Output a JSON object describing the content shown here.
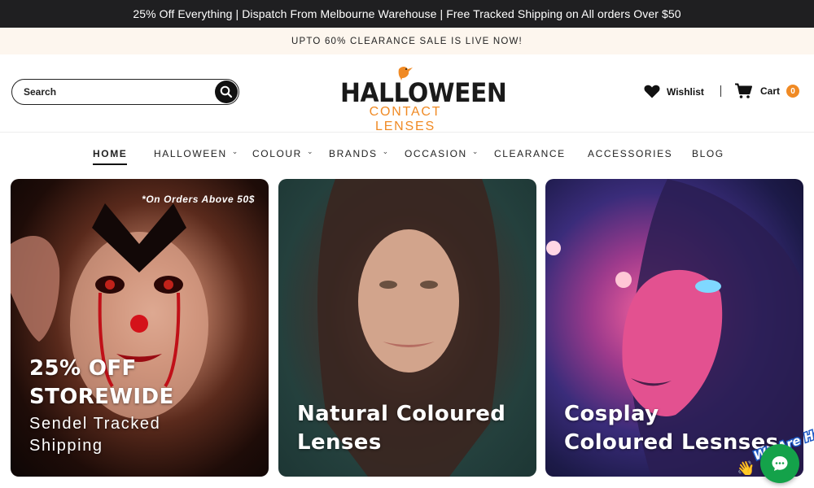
{
  "announcement": "25% Off Everything | Dispatch From Melbourne Warehouse | Free Tracked Shipping on All orders Over $50",
  "sale_banner": "UPTO 60% CLEARANCE SALE IS LIVE NOW!",
  "header": {
    "search_placeholder": "Search",
    "logo_title": "HALLOWEEN",
    "logo_subtitle": "CONTACT LENSES",
    "wishlist_label": "Wishlist",
    "cart_label": "Cart",
    "cart_count": "0"
  },
  "nav": {
    "items": [
      {
        "label": "HOME",
        "active": true,
        "dropdown": false
      },
      {
        "label": "HALLOWEEN",
        "dropdown": true
      },
      {
        "label": "COLOUR",
        "dropdown": true
      },
      {
        "label": "BRANDS",
        "dropdown": true
      },
      {
        "label": "OCCASION",
        "dropdown": true
      },
      {
        "label": "CLEARANCE",
        "dropdown": false
      },
      {
        "label": "ACCESSORIES",
        "dropdown": false
      },
      {
        "label": "BLOG",
        "dropdown": false
      }
    ]
  },
  "cards": [
    {
      "note": "*On Orders Above 50$",
      "title_line1": "25% OFF",
      "title_line2": "STOREWIDE",
      "sub_line1": "Sendel Tracked",
      "sub_line2": "Shipping"
    },
    {
      "title_line1": "Natural Coloured",
      "title_line2": "Lenses"
    },
    {
      "title_line1": "Cosplay",
      "title_line2": "Coloured Lesnses"
    }
  ],
  "chat": {
    "tag": "We Are Here!"
  },
  "colors": {
    "accent": "#f08a24",
    "dark_bar": "#1f1f21",
    "sale_bg": "#fdf6ee",
    "chat_green": "#14a24a"
  },
  "icons": [
    "search-icon",
    "heart-icon",
    "cart-icon",
    "chevron-down-icon",
    "chat-icon",
    "bird-icon",
    "wave-hand-icon"
  ]
}
